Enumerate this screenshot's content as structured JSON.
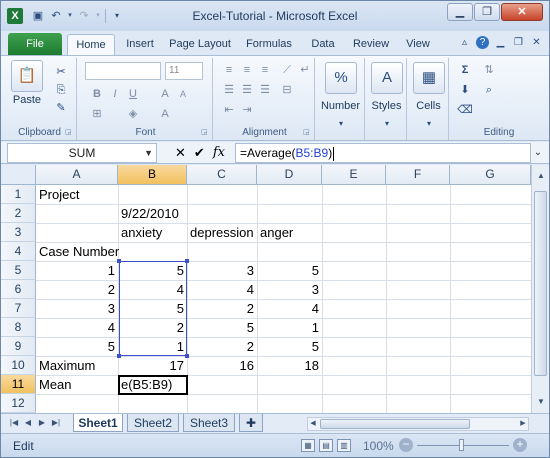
{
  "window": {
    "title": "Excel-Tutorial - Microsoft Excel",
    "app_icon": "X",
    "qat_icons": [
      "save-icon",
      "undo-icon",
      "redo-icon",
      "customize-qat-icon"
    ],
    "controls": [
      "minimize-icon",
      "restore-icon",
      "close-icon"
    ]
  },
  "ribbon": {
    "file_tab": "File",
    "tabs": [
      "Home",
      "Insert",
      "Page Layout",
      "Formulas",
      "Data",
      "Review",
      "View"
    ],
    "active_tab": "Home",
    "groups": {
      "clipboard": {
        "label": "Clipboard",
        "paste_label": "Paste"
      },
      "font": {
        "label": "Font",
        "font_size": "11"
      },
      "alignment": {
        "label": "Alignment"
      },
      "number": {
        "label": "Number",
        "icon_text": "%"
      },
      "styles": {
        "label": "Styles",
        "icon_text": "A"
      },
      "cells": {
        "label": "Cells"
      },
      "editing": {
        "label": "Editing"
      }
    }
  },
  "formula_bar": {
    "name_box": "SUM",
    "formula_prefix": "=Average(",
    "formula_ref": "B5:B9",
    "formula_suffix": ")"
  },
  "grid": {
    "columns": [
      "A",
      "B",
      "C",
      "D",
      "E",
      "F",
      "G"
    ],
    "selected_column": "B",
    "rows": [
      "1",
      "2",
      "3",
      "4",
      "5",
      "6",
      "7",
      "8",
      "9",
      "10",
      "11",
      "12"
    ],
    "selected_row": "11",
    "cells": {
      "A1": "Project",
      "B2": "9/22/2010",
      "B3": "anxiety",
      "C3": "depression",
      "D3": "anger",
      "A4": "Case Number",
      "A5": "1",
      "B5": "5",
      "C5": "3",
      "D5": "5",
      "A6": "2",
      "B6": "4",
      "C6": "4",
      "D6": "3",
      "A7": "3",
      "B7": "5",
      "C7": "2",
      "D7": "4",
      "A8": "4",
      "B8": "2",
      "C8": "5",
      "D8": "1",
      "A9": "5",
      "B9": "1",
      "C9": "2",
      "D9": "5",
      "A10": "Maximum",
      "B10": "17",
      "C10": "16",
      "D10": "18",
      "A11": "Mean",
      "B11": "e(B5:B9)"
    }
  },
  "sheets": {
    "tabs": [
      "Sheet1",
      "Sheet2",
      "Sheet3"
    ],
    "active": "Sheet1"
  },
  "status": {
    "mode": "Edit",
    "zoom": "100%"
  },
  "colors": {
    "file_tab": "#1e7b31",
    "selection_border": "#3e52c8",
    "formula_ref": "#1f3fd0",
    "header_highlight": "#f1c15f"
  }
}
